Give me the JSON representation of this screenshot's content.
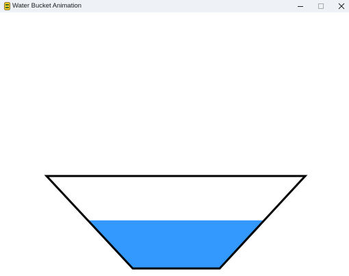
{
  "window": {
    "title": "Water Bucket Animation",
    "app_icon": "pygame-snake-icon",
    "controls": [
      "minimize-icon",
      "maximize-icon",
      "close-icon"
    ]
  },
  "scene": {
    "water_fill_level": 0.52,
    "colors": {
      "background": "#ffffff",
      "water": "#3399ff",
      "bucket_outline": "#000000"
    }
  }
}
